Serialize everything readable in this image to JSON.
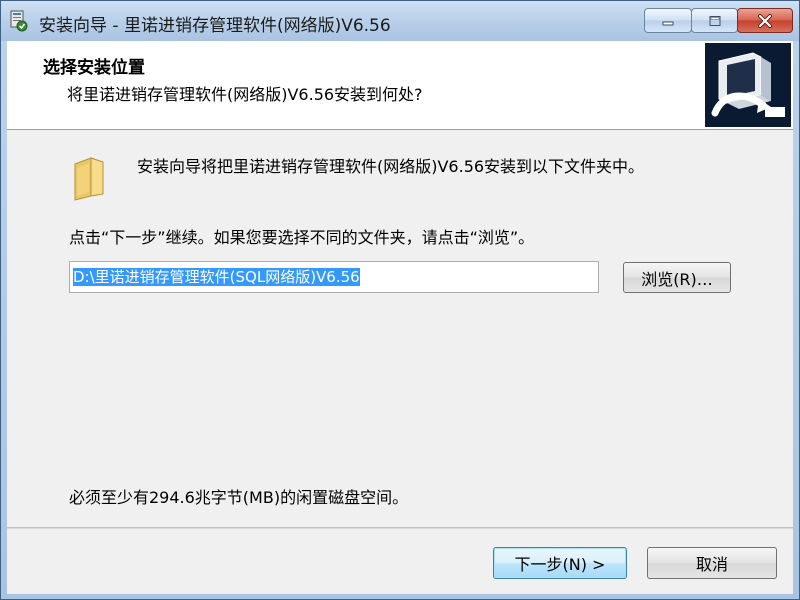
{
  "window": {
    "title": "安装向导 - 里诺进销存管理软件(网络版)V6.56",
    "controls": {
      "minimize": "minimize-icon",
      "maximize": "maximize-icon",
      "close": "close-icon"
    }
  },
  "header": {
    "title": "选择安装位置",
    "subtitle": "将里诺进销存管理软件(网络版)V6.56安装到何处?"
  },
  "body": {
    "info": "安装向导将把里诺进销存管理软件(网络版)V6.56安装到以下文件夹中。",
    "continue_hint": "点击“下一步”继续。如果您要选择不同的文件夹，请点击“浏览”。",
    "path_value": "D:\\里诺进销存管理软件(SQL网络版)V6.56",
    "browse_label": "浏览(R)…",
    "space_required": "必须至少有294.6兆字节(MB)的闲置磁盘空间。"
  },
  "footer": {
    "next_label": "下一步(N) >",
    "cancel_label": "取消"
  },
  "colors": {
    "accent_selection": "#3399ff",
    "close_button": "#c5402f",
    "title_bar": "#b9d0ea"
  }
}
